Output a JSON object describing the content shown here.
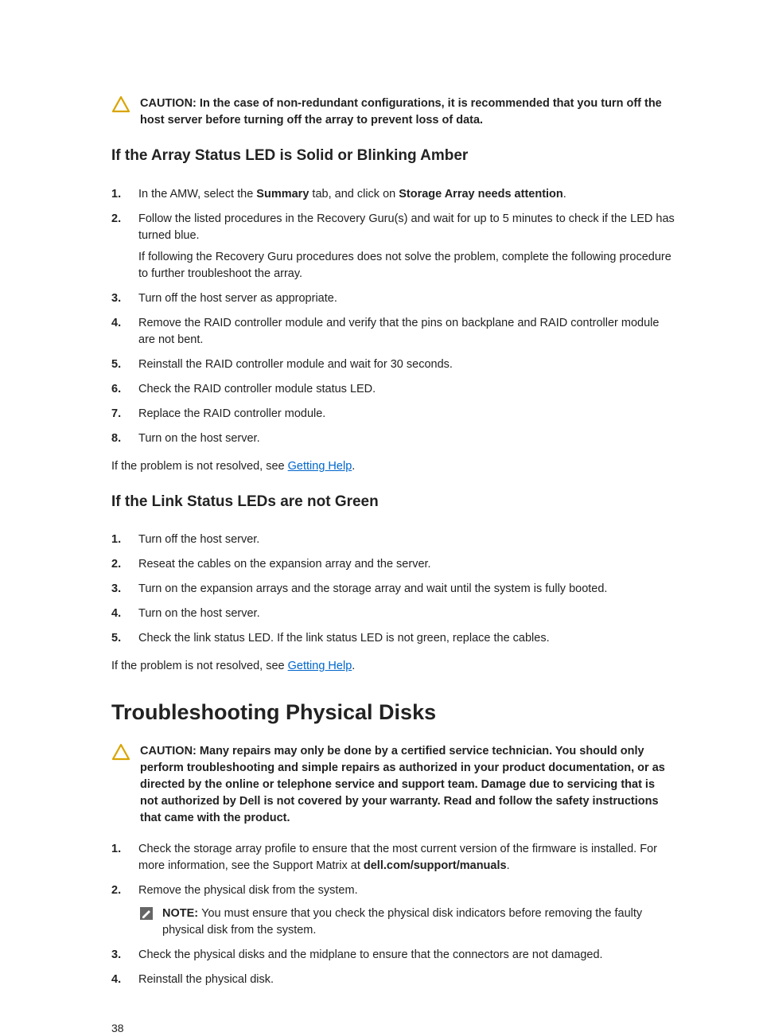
{
  "caution1": {
    "label": "CAUTION: ",
    "text": "In the case of non-redundant configurations, it is recommended that you turn off the host server before turning off the array to prevent loss of data."
  },
  "section1": {
    "heading": "If the Array Status LED is Solid or Blinking Amber",
    "steps": [
      {
        "pre": "In the AMW, select the ",
        "b1": "Summary",
        "mid": " tab, and click on ",
        "b2": "Storage Array needs attention",
        "post": "."
      },
      {
        "text": "Follow the listed procedures in the Recovery Guru(s) and wait for up to 5 minutes to check if the LED has turned blue.",
        "extra": "If following the Recovery Guru procedures does not solve the problem, complete the following procedure to further troubleshoot the array."
      },
      {
        "text": "Turn off the host server as appropriate."
      },
      {
        "text": "Remove the RAID controller module and verify that the pins on backplane and RAID controller module are not bent."
      },
      {
        "text": "Reinstall the RAID controller module and wait for 30 seconds."
      },
      {
        "text": "Check the RAID controller module status LED."
      },
      {
        "text": "Replace the RAID controller module."
      },
      {
        "text": "Turn on the host server."
      }
    ],
    "closing_pre": "If the problem is not resolved, see ",
    "closing_link": "Getting Help",
    "closing_post": "."
  },
  "section2": {
    "heading": "If the Link Status LEDs are not Green",
    "steps": [
      {
        "text": "Turn off the host server."
      },
      {
        "text": "Reseat the cables on the expansion array and the server."
      },
      {
        "text": "Turn on the expansion arrays and the storage array and wait until the system is fully booted."
      },
      {
        "text": "Turn on the host server."
      },
      {
        "text": "Check the link status LED. If the link status LED is not green, replace the cables."
      }
    ],
    "closing_pre": "If the problem is not resolved, see ",
    "closing_link": "Getting Help",
    "closing_post": "."
  },
  "section3": {
    "heading": "Troubleshooting Physical Disks",
    "caution": {
      "label": "CAUTION: ",
      "text": "Many repairs may only be done by a certified service technician. You should only perform troubleshooting and simple repairs as authorized in your product documentation, or as directed by the online or telephone service and support team. Damage due to servicing that is not authorized by Dell is not covered by your warranty. Read and follow the safety instructions that came with the product."
    },
    "steps": [
      {
        "text": "Check the storage array profile to ensure that the most current version of the firmware is installed. For more information, see the Support Matrix at ",
        "b1": "dell.com/support/manuals",
        "post": "."
      },
      {
        "text": "Remove the physical disk from the system.",
        "note_label": "NOTE: ",
        "note_text": "You must ensure that you check the physical disk indicators before removing the faulty physical disk from the system."
      },
      {
        "text": "Check the physical disks and the midplane to ensure that the connectors are not damaged."
      },
      {
        "text": "Reinstall the physical disk."
      }
    ]
  },
  "page_number": "38"
}
